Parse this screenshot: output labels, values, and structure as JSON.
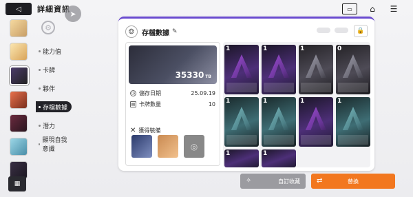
{
  "header": {
    "back_icon": "back-arrow-icon",
    "title": "詳細資訊",
    "nav_icon": "play-arrow-icon",
    "icons": [
      "id-card-icon",
      "home-icon",
      "menu-icon"
    ]
  },
  "sidebar": {
    "items": [
      {
        "label": "能力值"
      },
      {
        "label": "卡牌"
      },
      {
        "label": "夥伴"
      },
      {
        "label": "存檔數據",
        "active": true
      },
      {
        "label": "潛力"
      },
      {
        "label": "顯現自我意識"
      }
    ]
  },
  "panel": {
    "title": "存檔數據",
    "banner_value": "35330",
    "banner_unit": "TB",
    "save_date_label": "儲存日期",
    "save_date_value": "25.09.19",
    "card_count_label": "卡牌數量",
    "card_count_value": "10",
    "equipment_label": "獲得裝備"
  },
  "cards": [
    {
      "cost": "1"
    },
    {
      "cost": "1"
    },
    {
      "cost": "1"
    },
    {
      "cost": "0"
    },
    {
      "cost": "1"
    },
    {
      "cost": "1"
    },
    {
      "cost": "1"
    },
    {
      "cost": "1"
    },
    {
      "cost": "1"
    },
    {
      "cost": "1"
    }
  ],
  "buttons": {
    "custom_collection": "自訂收藏",
    "switch": "替換"
  },
  "colors": {
    "accent": "#6a4bd0",
    "switch_button": "#f2771f",
    "custom_button": "#9b9ba0"
  }
}
